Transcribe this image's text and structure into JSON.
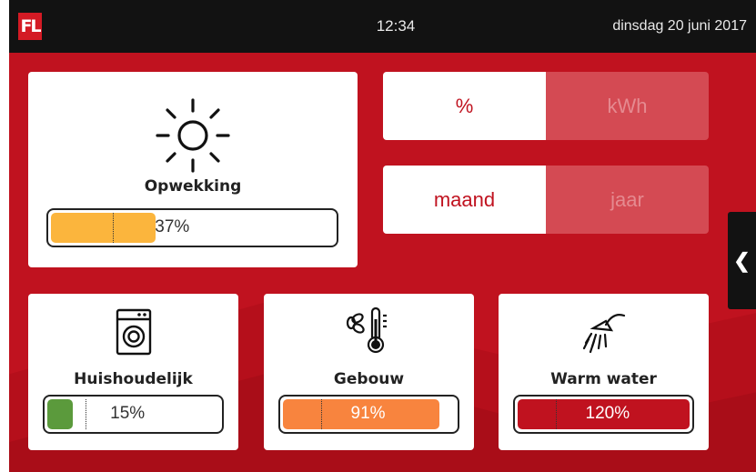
{
  "header": {
    "logo_text": "FL",
    "time": "12:34",
    "date": "dinsdag 20 juni 2017"
  },
  "main": {
    "title": "Opwekking",
    "percent": 37,
    "value_label": "37%",
    "color": "#fbb53d",
    "icon": "sun-icon"
  },
  "unit_toggle": {
    "selected": "%",
    "options": [
      "%",
      "kWh"
    ]
  },
  "period_toggle": {
    "selected": "maand",
    "options": [
      "maand",
      "jaar"
    ]
  },
  "side_tab": {
    "icon": "chevron-left-icon"
  },
  "categories": [
    {
      "title": "Huishoudelijk",
      "value_label": "15%",
      "percent": 15,
      "color": "#5b9a3c",
      "icon": "washing-machine-icon"
    },
    {
      "title": "Gebouw",
      "value_label": "91%",
      "percent": 91,
      "color": "#f8843e",
      "icon": "fan-thermometer-icon"
    },
    {
      "title": "Warm water",
      "value_label": "120%",
      "percent": 120,
      "color": "#c0121f",
      "icon": "shower-icon"
    }
  ],
  "colors": {
    "brand_red": "#c0121f",
    "header": "#121212",
    "toggle_inactive": "#d44a53"
  }
}
